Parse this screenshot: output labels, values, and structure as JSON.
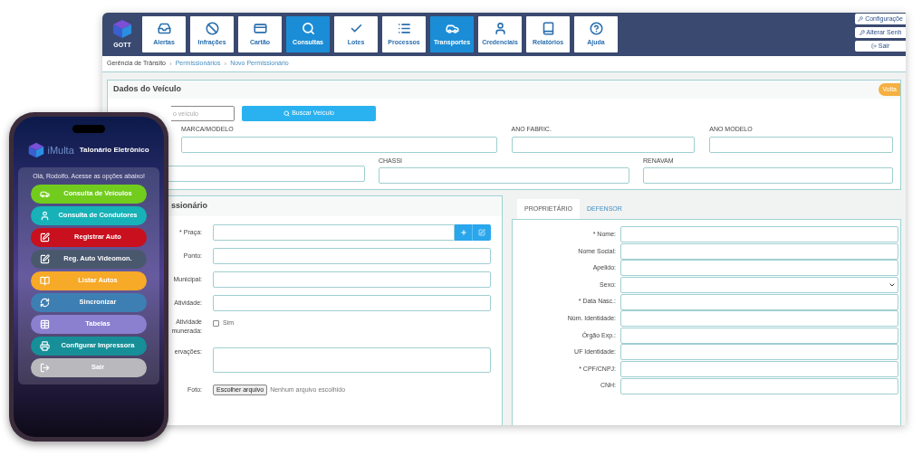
{
  "app": {
    "logo": "GOTT",
    "nav": [
      {
        "label": "Alertas",
        "selected": false
      },
      {
        "label": "Infrações",
        "selected": false
      },
      {
        "label": "Cartão",
        "selected": false
      },
      {
        "label": "Consultas",
        "selected": true
      },
      {
        "label": "Lotes",
        "selected": false
      },
      {
        "label": "Processos",
        "selected": false
      },
      {
        "label": "Transportes",
        "selected": true
      },
      {
        "label": "Credenciais",
        "selected": false
      },
      {
        "label": "Relatórios",
        "selected": false
      },
      {
        "label": "Ajuda",
        "selected": false
      }
    ],
    "top_links": [
      "Configuraçõe",
      "Alterar Senh",
      "Sair"
    ],
    "breadcrumb": [
      "Gerência de Trânsito",
      "Permissionários",
      "Novo Permissionário"
    ],
    "breadcrumb_separator": "›",
    "vehicle": {
      "title": "Dados do Veículo",
      "back": "Volta",
      "search_placeholder": "o veículo",
      "search_button": "Buscar Veículo",
      "row1": [
        {
          "kind": "input",
          "label": "MARCA/MODELO"
        },
        {
          "kind": "input",
          "label": "ANO FABRIC."
        },
        {
          "kind": "input",
          "label": "ANO MODELO"
        }
      ],
      "row2": [
        {
          "kind": "input"
        },
        {
          "kind": "input",
          "label": "CHASSI"
        },
        {
          "kind": "input",
          "label": "RENAVAM"
        }
      ]
    },
    "permit": {
      "title": "ssionário",
      "rows": [
        {
          "kind": "input_buttons",
          "label": "* Praça:"
        },
        {
          "kind": "input",
          "label": "Ponto:"
        },
        {
          "kind": "input",
          "label": "Municipal:"
        },
        {
          "kind": "input",
          "label": "Atividade:"
        },
        {
          "kind": "checkbox",
          "label": "Atividade munerada:",
          "option": "Sim",
          "checked": false
        },
        {
          "kind": "textarea",
          "label": "ervações:"
        },
        {
          "kind": "file",
          "label": "Foto:",
          "button": "Escolher arquivo",
          "status": "Nenhum arquivo escolhido"
        }
      ]
    },
    "owner": {
      "tabs": [
        {
          "label": "PROPRIETÁRIO",
          "selected": true
        },
        {
          "label": "DEFENSOR",
          "selected": false
        }
      ],
      "rows": [
        {
          "kind": "input",
          "label": "* Nome:"
        },
        {
          "kind": "input",
          "label": "Nome Social:"
        },
        {
          "kind": "input",
          "label": "Apelido:"
        },
        {
          "kind": "select",
          "label": "Sexo:"
        },
        {
          "kind": "input",
          "label": "* Data Nasc.:"
        },
        {
          "kind": "input",
          "label": "Núm. Identidade:"
        },
        {
          "kind": "input",
          "label": "Órgão Exp.:"
        },
        {
          "kind": "input",
          "label": "UF Identidade:"
        },
        {
          "kind": "input",
          "label": "* CPF/CNPJ:"
        },
        {
          "kind": "input",
          "label": "CNH:"
        }
      ]
    }
  },
  "phone": {
    "brand": "iMulta",
    "subtitle": "Talonário Eletrônico",
    "greeting": "Olá, Rodolfo. Acesse as opções abaixo!",
    "buttons": [
      {
        "label": "Consulta de Veículos",
        "color": "#72cc1e"
      },
      {
        "label": "Consulta de Condutores",
        "color": "#17b2b8"
      },
      {
        "label": "Registrar Auto",
        "color": "#c8101e"
      },
      {
        "label": "Reg. Auto Videomon.",
        "color": "#4a586e"
      },
      {
        "label": "Listar Autos",
        "color": "#f7a928"
      },
      {
        "label": "Sincronizar",
        "color": "#3d7fb3"
      },
      {
        "label": "Tabelas",
        "color": "#8b7fcf"
      },
      {
        "label": "Configurar Impressora",
        "color": "#168f98"
      },
      {
        "label": "Sair",
        "color": "#b9b9bd"
      }
    ]
  }
}
